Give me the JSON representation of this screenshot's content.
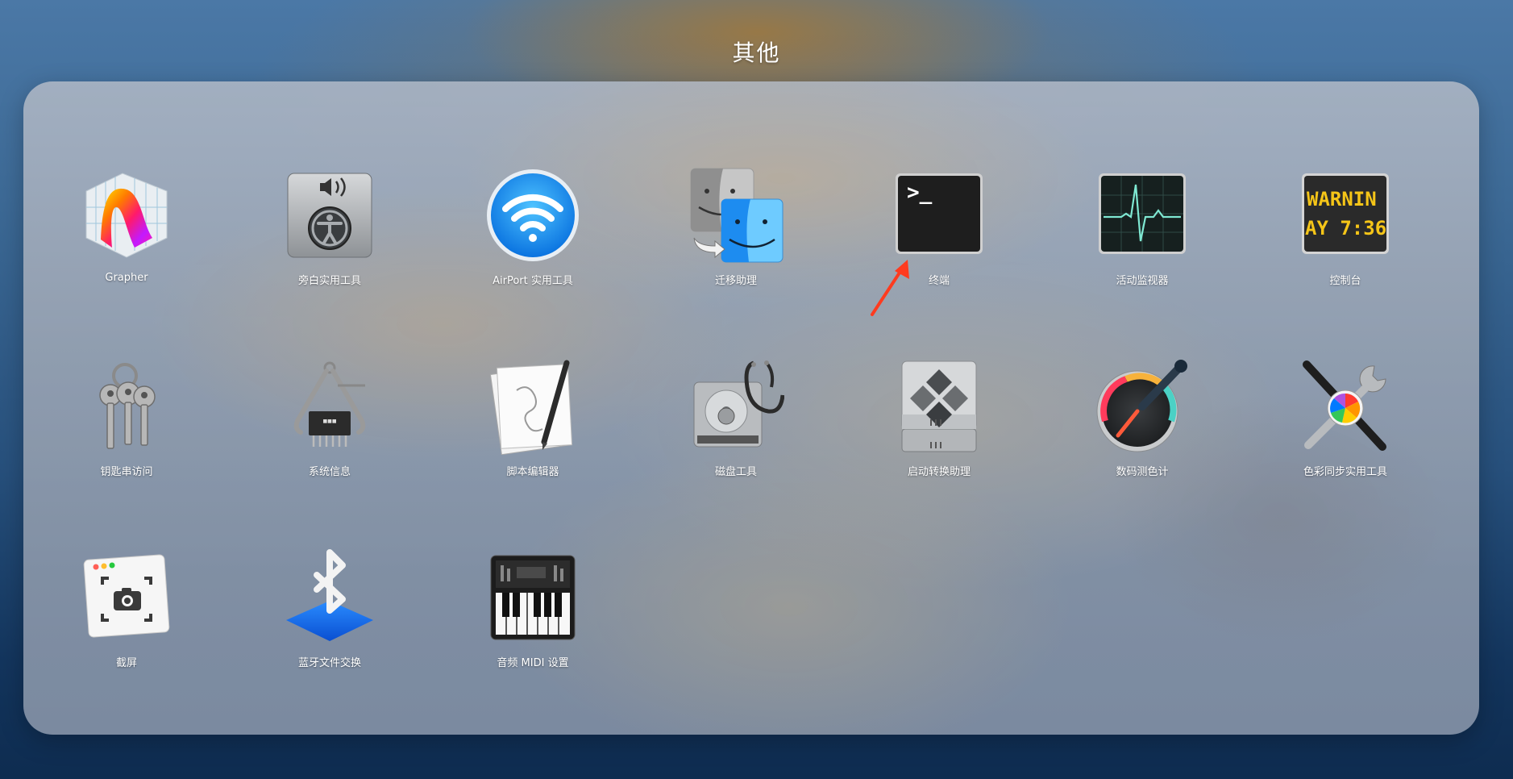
{
  "folder": {
    "title": "其他"
  },
  "apps": [
    {
      "name": "Grapher",
      "icon": "grapher-icon"
    },
    {
      "name": "旁白实用工具",
      "icon": "voiceover-utility-icon"
    },
    {
      "name": "AirPort 实用工具",
      "icon": "airport-utility-icon"
    },
    {
      "name": "迁移助理",
      "icon": "migration-assistant-icon"
    },
    {
      "name": "终端",
      "icon": "terminal-icon",
      "icon_text": ">_"
    },
    {
      "name": "活动监视器",
      "icon": "activity-monitor-icon"
    },
    {
      "name": "控制台",
      "icon": "console-icon",
      "icon_text_1": "WARNIN",
      "icon_text_2": "AY 7:36"
    },
    {
      "name": "钥匙串访问",
      "icon": "keychain-access-icon"
    },
    {
      "name": "系统信息",
      "icon": "system-information-icon"
    },
    {
      "name": "脚本编辑器",
      "icon": "script-editor-icon"
    },
    {
      "name": "磁盘工具",
      "icon": "disk-utility-icon"
    },
    {
      "name": "启动转换助理",
      "icon": "boot-camp-assistant-icon"
    },
    {
      "name": "数码测色计",
      "icon": "digital-color-meter-icon"
    },
    {
      "name": "色彩同步实用工具",
      "icon": "colorsync-utility-icon"
    },
    {
      "name": "截屏",
      "icon": "screenshot-icon"
    },
    {
      "name": "蓝牙文件交换",
      "icon": "bluetooth-file-exchange-icon"
    },
    {
      "name": "音频 MIDI 设置",
      "icon": "audio-midi-setup-icon"
    }
  ],
  "colors": {
    "arrow": "#ff3b1f",
    "console_text": "#f5c518",
    "terminal_bg": "#1e1e1e"
  }
}
